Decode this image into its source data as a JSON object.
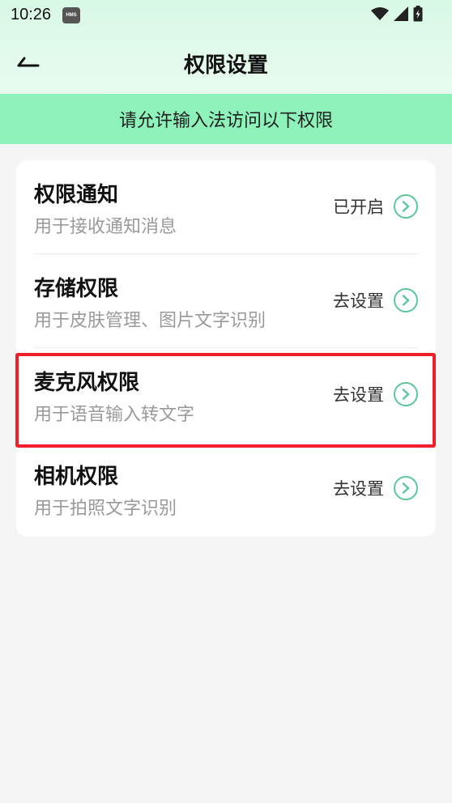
{
  "status_bar": {
    "time": "10:26",
    "badge": "HMS"
  },
  "header": {
    "title": "权限设置"
  },
  "banner": {
    "text": "请允许输入法访问以下权限"
  },
  "permissions": [
    {
      "title": "权限通知",
      "desc": "用于接收通知消息",
      "status": "已开启"
    },
    {
      "title": "存储权限",
      "desc": "用于皮肤管理、图片文字识别",
      "status": "去设置"
    },
    {
      "title": "麦克风权限",
      "desc": "用于语音输入转文字",
      "status": "去设置"
    },
    {
      "title": "相机权限",
      "desc": "用于拍照文字识别",
      "status": "去设置"
    }
  ],
  "colors": {
    "banner": "#8ef3bb",
    "accent": "#5cc79a",
    "highlight": "#f0202a"
  }
}
